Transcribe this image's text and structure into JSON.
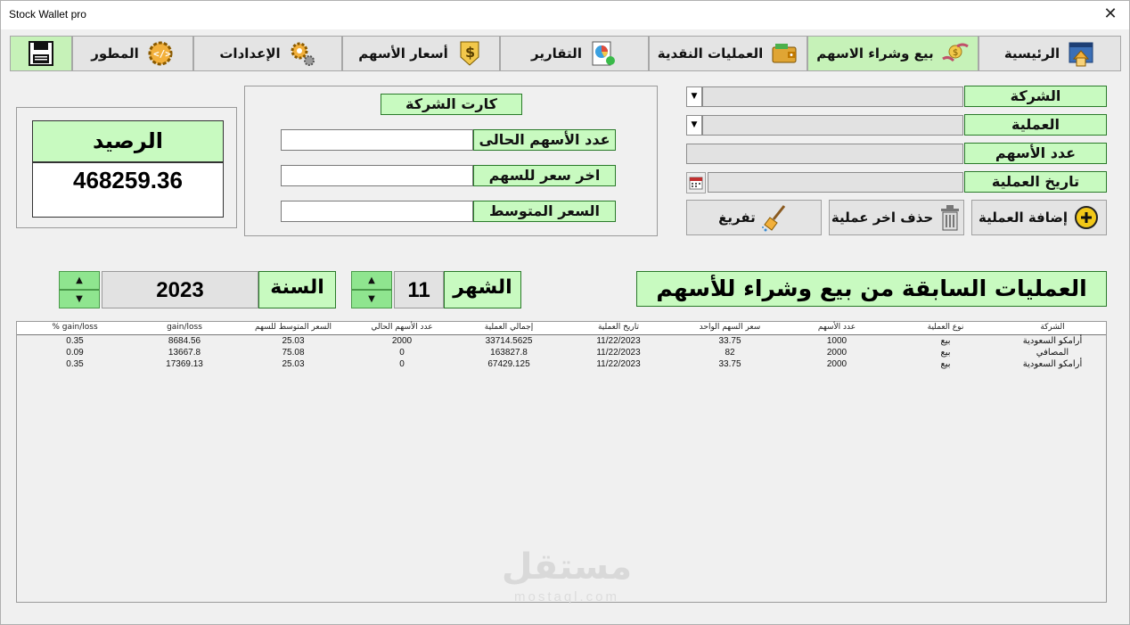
{
  "window": {
    "title": "Stock Wallet pro",
    "close_glyph": "✕"
  },
  "toolbar": {
    "tabs": [
      {
        "label": "الرئيسية",
        "icon": "home-icon"
      },
      {
        "label": "بيع وشراء الاسهم",
        "icon": "money-hands-icon",
        "active": true
      },
      {
        "label": "العمليات النقدية",
        "icon": "wallet-icon"
      },
      {
        "label": "التقارير",
        "icon": "report-chart-icon"
      },
      {
        "label": "أسعار الأسهم",
        "icon": "dollar-shield-icon"
      },
      {
        "label": "الإعدادات",
        "icon": "gear-icon"
      },
      {
        "label": "المطور",
        "icon": "developer-code-icon"
      },
      {
        "label": "",
        "icon": "save-disk-icon"
      }
    ]
  },
  "form": {
    "company_label": "الشركة",
    "operation_label": "العملية",
    "shares_count_label": "عدد الأسهم",
    "operation_date_label": "تاريخ العملية",
    "company_value": "",
    "operation_value": "",
    "shares_value": "",
    "date_value": "",
    "add_button": "إضافة العملية",
    "delete_last_button": "حذف اخر عملية",
    "clear_button": "تفريغ"
  },
  "company_card": {
    "title": "كارت الشركة",
    "current_shares_label": "عدد الأسهم الحالى",
    "last_price_label": "اخر سعر للسهم",
    "average_price_label": "السعر المتوسط",
    "current_shares_value": "",
    "last_price_value": "",
    "average_price_value": ""
  },
  "balance": {
    "label": "الرصيد",
    "value": "468259.36"
  },
  "history": {
    "title": "العمليات السابقة من بيع وشراء للأسهم",
    "month_label": "الشهر",
    "month_value": "11",
    "year_label": "السنة",
    "year_value": "2023"
  },
  "table": {
    "columns": [
      "الشركة",
      "نوع العملية",
      "عدد الأسهم",
      "سعر السهم الواحد",
      "تاريخ العملية",
      "إجمالي العملية",
      "عدد الأسهم الحالي",
      "السعر المتوسط للسهم",
      "gain/loss",
      "gain/loss %"
    ],
    "rows": [
      [
        "أرامكو السعودية",
        "بيع",
        "1000",
        "33.75",
        "11/22/2023",
        "33714.5625",
        "2000",
        "25.03",
        "8684.56",
        "0.35"
      ],
      [
        "المصافي",
        "بيع",
        "2000",
        "82",
        "11/22/2023",
        "163827.8",
        "0",
        "75.08",
        "13667.8",
        "0.09"
      ],
      [
        "أرامكو السعودية",
        "بيع",
        "2000",
        "33.75",
        "11/22/2023",
        "67429.125",
        "0",
        "25.03",
        "17369.13",
        "0.35"
      ]
    ]
  },
  "watermark": {
    "text": "مستقل",
    "sub": "mostaql.com"
  },
  "colors": {
    "accent_green": "#c8fac0",
    "spin_green": "#8fe58f",
    "tab_bg": "#e4e4e4"
  }
}
